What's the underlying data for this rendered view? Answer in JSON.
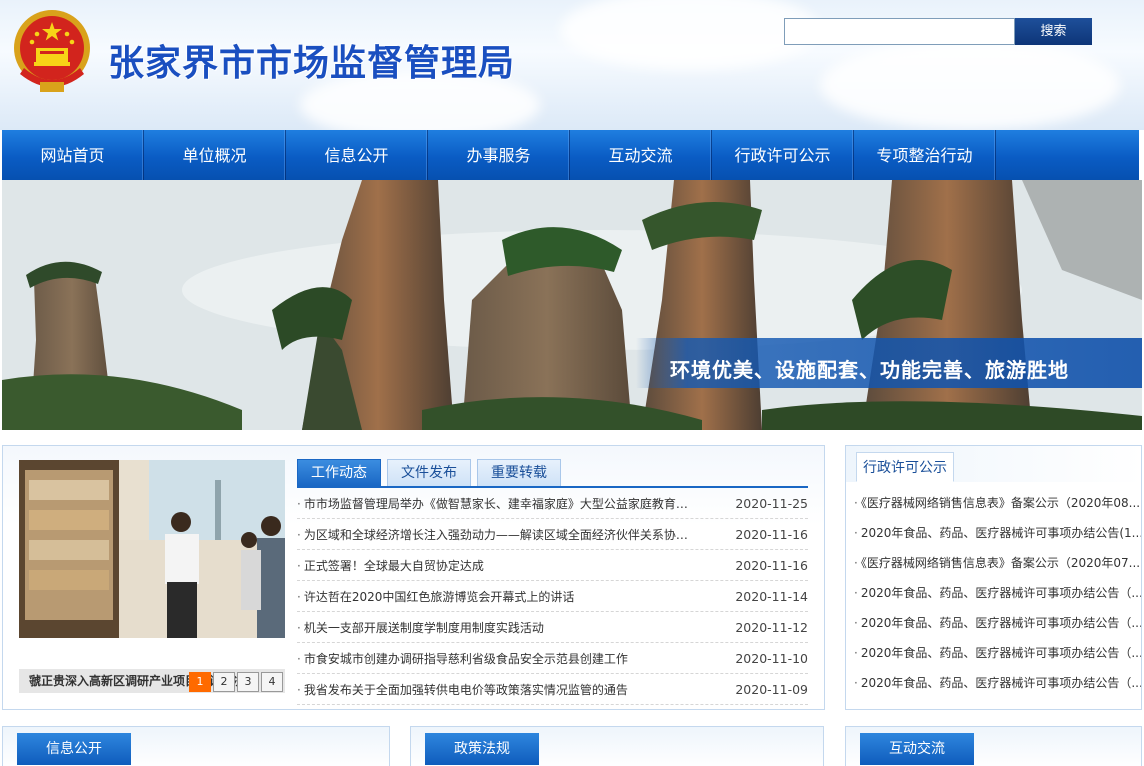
{
  "header": {
    "title": "张家界市市场监督管理局",
    "emblem_icon": "national-emblem-icon",
    "search": {
      "placeholder": "",
      "value": "",
      "button_label": "搜索"
    }
  },
  "nav": {
    "items": [
      {
        "label": "网站首页"
      },
      {
        "label": "单位概况"
      },
      {
        "label": "信息公开"
      },
      {
        "label": "办事服务"
      },
      {
        "label": "互动交流"
      },
      {
        "label": "行政许可公示"
      },
      {
        "label": "专项整治行动"
      }
    ]
  },
  "banner": {
    "slogan": "环境优美、设施配套、功能完善、旅游胜地"
  },
  "news": {
    "photo_caption": "虢正贵深入高新区调研产业项目建设情况",
    "pager": [
      "1",
      "2",
      "3",
      "4"
    ],
    "active_page": "1",
    "tabs": [
      {
        "label": "工作动态",
        "active": true
      },
      {
        "label": "文件发布",
        "active": false
      },
      {
        "label": "重要转载",
        "active": false
      }
    ],
    "items": [
      {
        "title": "市市场监督管理局举办《做智慧家长、建幸福家庭》大型公益家庭教育讲座",
        "date": "2020-11-25"
      },
      {
        "title": "为区域和全球经济增长注入强劲动力——解读区域全面经济伙伴关系协定...",
        "date": "2020-11-16"
      },
      {
        "title": "正式签署！全球最大自贸协定达成",
        "date": "2020-11-16"
      },
      {
        "title": "许达哲在2020中国红色旅游博览会开幕式上的讲话",
        "date": "2020-11-14"
      },
      {
        "title": "机关一支部开展送制度学制度用制度实践活动",
        "date": "2020-11-12"
      },
      {
        "title": "市食安城市创建办调研指导慈利省级食品安全示范县创建工作",
        "date": "2020-11-10"
      },
      {
        "title": "我省发布关于全面加强转供电电价等政策落实情况监管的通告",
        "date": "2020-11-09"
      }
    ]
  },
  "license": {
    "tab": "行政许可公示",
    "items": [
      "《医疗器械网络销售信息表》备案公示（2020年08...",
      "2020年食品、药品、医疗器械许可事项办结公告(1...",
      "《医疗器械网络销售信息表》备案公示（2020年07...",
      "2020年食品、药品、医疗器械许可事项办结公告（...",
      "2020年食品、药品、医疗器械许可事项办结公告（...",
      "2020年食品、药品、医疗器械许可事项办结公告（...",
      "2020年食品、药品、医疗器械许可事项办结公告（..."
    ]
  },
  "sections": [
    {
      "label": "信息公开"
    },
    {
      "label": "政策法规"
    },
    {
      "label": "互动交流"
    }
  ],
  "colors": {
    "nav_blue": "#0a5cc4",
    "title_blue": "#1a4fc0",
    "pager_active": "#ff6a00",
    "search_button": "#0d3578"
  }
}
